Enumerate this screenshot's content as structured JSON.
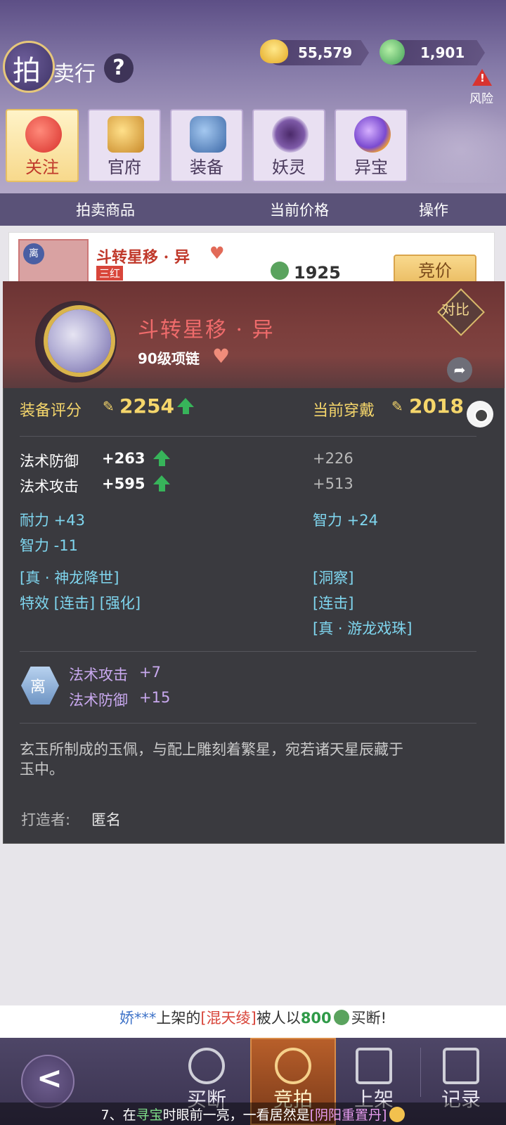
{
  "header": {
    "logo_char": "拍",
    "logo_rest": "卖行",
    "help": "?",
    "gold": "55,579",
    "jade": "1,901",
    "risk_label": "风险"
  },
  "categories": [
    {
      "label": "关注",
      "icon": "heart-icon",
      "active": true
    },
    {
      "label": "官府",
      "icon": "gavel-icon"
    },
    {
      "label": "装备",
      "icon": "armor-icon"
    },
    {
      "label": "妖灵",
      "icon": "spirit-icon"
    },
    {
      "label": "异宝",
      "icon": "treasure-orb-icon"
    }
  ],
  "columns": {
    "goods": "拍卖商品",
    "price": "当前价格",
    "action": "操作"
  },
  "list_item": {
    "badge": "离",
    "name": "斗转星移 · 异",
    "tag": "三红",
    "price": "1925",
    "bid": "竞价"
  },
  "detail": {
    "name": "斗转星移 · 异",
    "type": "90级项链",
    "compare": "对比",
    "score_label": "装备评分",
    "score": "2254",
    "current_label": "当前穿戴",
    "current_score": "2018",
    "stats": [
      {
        "label": "法术防御",
        "value": "+263",
        "current": "+226"
      },
      {
        "label": "法术攻击",
        "value": "+595",
        "current": "+513"
      }
    ],
    "attrs_left": [
      "耐力 +43",
      "智力 -11"
    ],
    "attrs_right": [
      "智力 +24"
    ],
    "skills_left": [
      "[真 · 神龙降世]",
      "特效 [连击] [强化]"
    ],
    "skills_right": [
      "[洞察]",
      "[连击]",
      "[真 · 游龙戏珠]"
    ],
    "gem_char": "离",
    "gem_attrs": [
      "法术攻击",
      "+7",
      "法术防御",
      "+15"
    ],
    "description": "玄玉所制成的玉佩，与配上雕刻着繁星，宛若诸天星辰藏于玉中。",
    "maker_label": "打造者:",
    "maker": "匿名"
  },
  "ticker": {
    "user": "娇***",
    "mid1": "上架的",
    "item": "[混天绫]",
    "mid2": "被人以",
    "amount": "800",
    "end": "买断!"
  },
  "nav": [
    {
      "label": "买断",
      "icon": "buyout-icon"
    },
    {
      "label": "竞拍",
      "icon": "scales-icon",
      "active": true
    },
    {
      "label": "上架",
      "icon": "stall-icon"
    },
    {
      "label": "记录",
      "icon": "record-icon"
    }
  ],
  "tip": {
    "prefix": "7、在",
    "place": "寻宝",
    "mid": "时眼前一亮，一看居然是",
    "item": "[阴阳重置丹]"
  },
  "colors": {
    "header_purple": "#857aa8",
    "panel_dark": "#3a3a3f",
    "gold_text": "#f5d66b",
    "red_name": "#ef6b6b",
    "attr_blue": "#7fd6ef",
    "gem_purple": "#c9a9ef"
  }
}
